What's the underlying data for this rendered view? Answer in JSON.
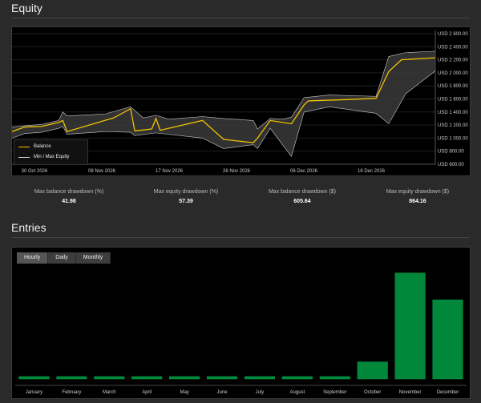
{
  "equity_section": {
    "title": "Equity"
  },
  "equity_chart": {
    "type": "line",
    "x_labels": [
      "30 Oct 2026",
      "08 Nov 2026",
      "17 Nov 2026",
      "26 Nov 2026",
      "06 Dec 2026",
      "16 Dec 2026"
    ],
    "y_labels": [
      "USD 2 600.00",
      "USD 2 400.00",
      "USD 2 200.00",
      "USD 2 000.00",
      "USD 1 800.00",
      "USD 1 600.00",
      "USD 1 400.00",
      "USD 1 200.00",
      "USD 1 000.00",
      "USD 800.00",
      "USD 600.00"
    ],
    "ylim": [
      600,
      2600
    ],
    "legend": {
      "balance": "Balance",
      "minmax": "Min / Max Equity"
    },
    "colors": {
      "balance": "#f2c200",
      "minmax": "#cccccc",
      "band": "#3a3a3a"
    },
    "balance": [
      [
        0,
        1100
      ],
      [
        3,
        1170
      ],
      [
        7,
        1180
      ],
      [
        11,
        1240
      ],
      [
        12,
        1270
      ],
      [
        13,
        1100
      ],
      [
        24,
        1310
      ],
      [
        28,
        1450
      ],
      [
        29,
        1110
      ],
      [
        33,
        1140
      ],
      [
        34,
        1300
      ],
      [
        35,
        1120
      ],
      [
        45,
        1270
      ],
      [
        50,
        980
      ],
      [
        57,
        930
      ],
      [
        58,
        1000
      ],
      [
        61,
        1270
      ],
      [
        66,
        1220
      ],
      [
        69,
        1510
      ],
      [
        70,
        1570
      ],
      [
        79,
        1590
      ],
      [
        86,
        1610
      ],
      [
        89,
        2020
      ],
      [
        92,
        2200
      ],
      [
        100,
        2230
      ]
    ],
    "max_equity": [
      [
        0,
        1170
      ],
      [
        3,
        1190
      ],
      [
        7,
        1210
      ],
      [
        11,
        1270
      ],
      [
        12,
        1400
      ],
      [
        13,
        1340
      ],
      [
        22,
        1370
      ],
      [
        28,
        1480
      ],
      [
        31,
        1310
      ],
      [
        34,
        1350
      ],
      [
        37,
        1290
      ],
      [
        45,
        1330
      ],
      [
        50,
        1300
      ],
      [
        57,
        1270
      ],
      [
        58,
        1140
      ],
      [
        61,
        1300
      ],
      [
        64,
        1290
      ],
      [
        66,
        1320
      ],
      [
        69,
        1620
      ],
      [
        75,
        1660
      ],
      [
        86,
        1640
      ],
      [
        89,
        2250
      ],
      [
        93,
        2310
      ],
      [
        100,
        2330
      ]
    ],
    "min_equity": [
      [
        0,
        1000
      ],
      [
        3,
        1070
      ],
      [
        7,
        1090
      ],
      [
        11,
        1150
      ],
      [
        12,
        1180
      ],
      [
        13,
        1060
      ],
      [
        22,
        1100
      ],
      [
        28,
        1090
      ],
      [
        29,
        1040
      ],
      [
        34,
        1080
      ],
      [
        45,
        1000
      ],
      [
        50,
        840
      ],
      [
        57,
        900
      ],
      [
        58,
        840
      ],
      [
        61,
        1150
      ],
      [
        66,
        720
      ],
      [
        69,
        1400
      ],
      [
        75,
        1480
      ],
      [
        86,
        1380
      ],
      [
        89,
        1220
      ],
      [
        93,
        1680
      ],
      [
        100,
        2030
      ]
    ]
  },
  "stats": [
    {
      "label": "Max balance drawdown (%)",
      "value": "41.98"
    },
    {
      "label": "Max equity drawdown (%)",
      "value": "57.39"
    },
    {
      "label": "Max balance drawdown ($)",
      "value": "605.64"
    },
    {
      "label": "Max equity drawdown ($)",
      "value": "864.16"
    }
  ],
  "entries_section": {
    "title": "Entries"
  },
  "entries_tabs": [
    {
      "label": "Hourly",
      "active": true
    },
    {
      "label": "Daily",
      "active": false
    },
    {
      "label": "Monthly",
      "active": false
    }
  ],
  "chart_data": {
    "type": "bar",
    "categories": [
      "January",
      "February",
      "March",
      "April",
      "May",
      "June",
      "July",
      "August",
      "September",
      "October",
      "November",
      "December"
    ],
    "values": [
      2,
      2,
      2,
      2,
      2,
      2,
      2,
      2,
      2,
      14,
      87,
      65
    ],
    "ylim": [
      0,
      100
    ],
    "colors": {
      "bar": "#00873a",
      "bar_border": "#00a347"
    }
  }
}
